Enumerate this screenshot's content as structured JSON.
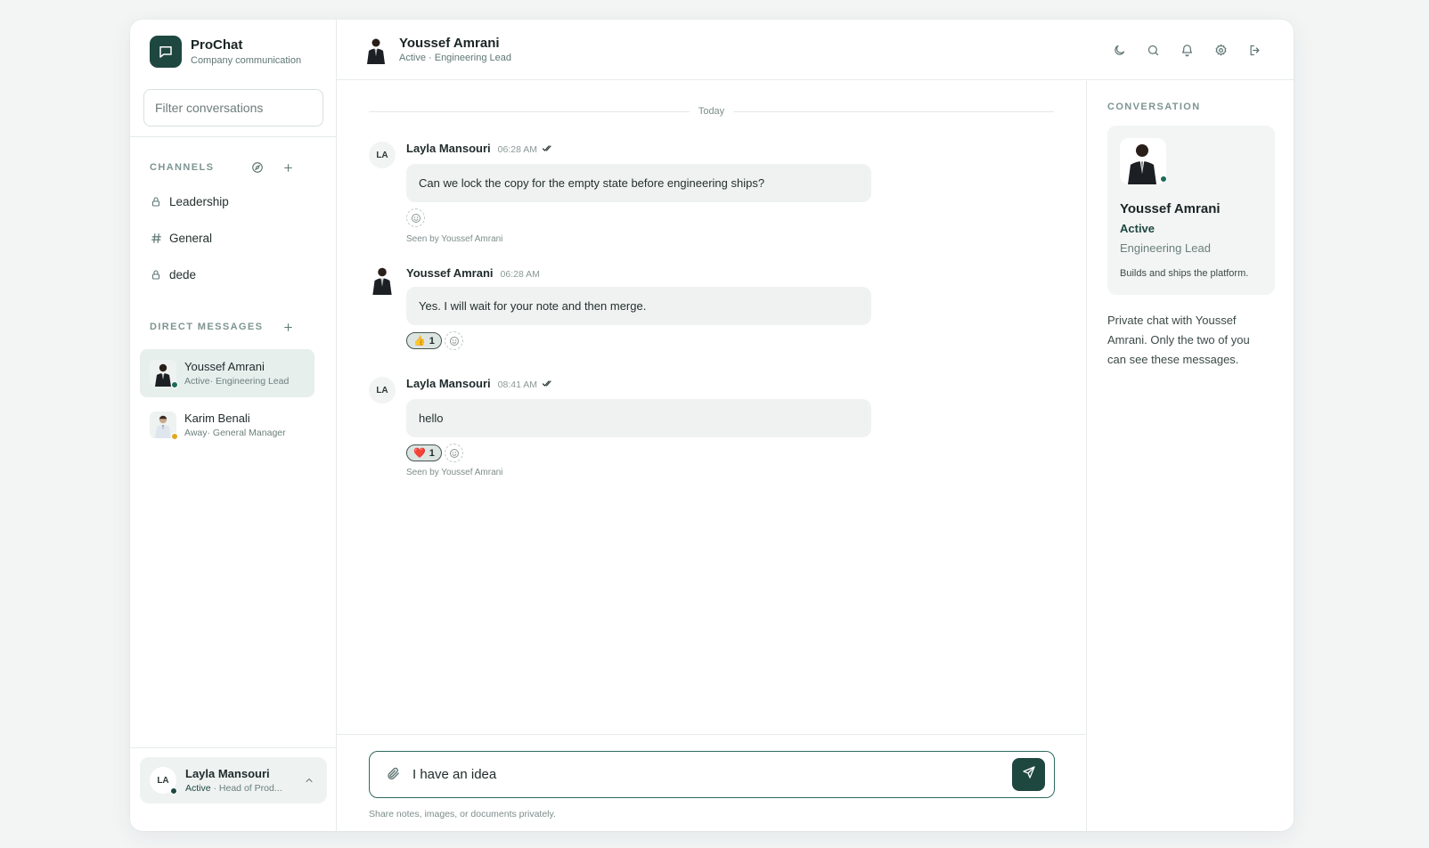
{
  "brand": {
    "name": "ProChat",
    "subtitle": "Company communication"
  },
  "sidebar": {
    "filter_placeholder": "Filter conversations",
    "channels_label": "CHANNELS",
    "channels": [
      {
        "name": "Leadership",
        "icon": "lock-icon"
      },
      {
        "name": "General",
        "icon": "hash-icon"
      },
      {
        "name": "dede",
        "icon": "lock-icon"
      }
    ],
    "dm_label": "DIRECT MESSAGES",
    "dms": [
      {
        "name": "Youssef Amrani",
        "status": "Active· Engineering Lead",
        "status_color": "#1e6b5a",
        "active": true
      },
      {
        "name": "Karim Benali",
        "status": "Away· General Manager",
        "status_color": "#e0a820",
        "active": false
      }
    ],
    "me": {
      "initials": "LA",
      "name": "Layla Mansouri",
      "status": "Active",
      "role": " · Head of Prod..."
    }
  },
  "header": {
    "name": "Youssef Amrani",
    "subtitle": "Active · Engineering Lead",
    "icons": [
      "moon-icon",
      "search-icon",
      "bell-icon",
      "settings-icon",
      "logout-icon"
    ]
  },
  "chat": {
    "day_label": "Today",
    "messages": [
      {
        "initials": "LA",
        "author": "Layla Mansouri",
        "time": "06:28 AM",
        "text": "Can we lock the copy for the empty state before engineering ships?",
        "seen": "Seen by Youssef Amrani"
      },
      {
        "author": "Youssef Amrani",
        "time": "06:28 AM",
        "text": "Yes. I will wait for your note and then merge.",
        "reaction": {
          "emoji": "👍",
          "count": "1"
        }
      },
      {
        "initials": "LA",
        "author": "Layla Mansouri",
        "time": "08:41 AM",
        "text": "hello",
        "reaction": {
          "emoji": "❤️",
          "count": "1"
        },
        "seen": "Seen by Youssef Amrani"
      }
    ]
  },
  "panel": {
    "label": "CONVERSATION",
    "name": "Youssef Amrani",
    "status": "Active",
    "role": "Engineering Lead",
    "bio": "Builds and ships the platform.",
    "note": "Private chat with Youssef Amrani. Only the two of you can see these messages."
  },
  "composer": {
    "value": "I have an idea",
    "hint": "Share notes, images, or documents privately."
  },
  "colors": {
    "accent": "#1e4740",
    "active_status": "#1e6b5a",
    "away_status": "#e0a820"
  }
}
